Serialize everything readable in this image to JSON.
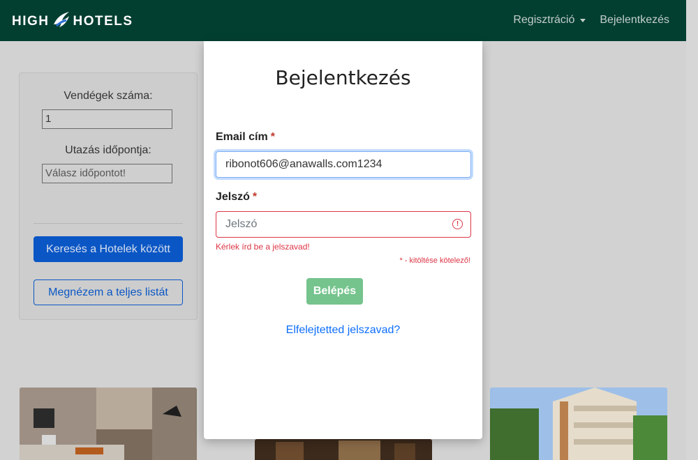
{
  "brand": {
    "left": "HIGH",
    "right": "HOTELS"
  },
  "nav": {
    "register": "Regisztráció",
    "login": "Bejelentkezés"
  },
  "search_panel": {
    "guests_label": "Vendégek száma:",
    "guests_value": "1",
    "date_label": "Utazás időpontja:",
    "date_placeholder": "Válasz időpontot!",
    "search_button": "Keresés a Hotelek között",
    "list_button": "Megnézem a teljes listát"
  },
  "modal": {
    "title": "Bejelentkezés",
    "email_label": "Email cím",
    "required_mark": "*",
    "email_value": "ribonot606@anawalls.com1234",
    "password_label": "Jelszó",
    "password_placeholder": "Jelszó",
    "password_error": "Kérlek írd be a jelszavad!",
    "required_note": "* - kitöltése kötelező!",
    "login_button": "Belépés",
    "forgot_link": "Elfelejtetted jelszavad?"
  },
  "colors": {
    "navbar": "#023f31",
    "primary": "#0a56c5",
    "error": "#dc3545",
    "success": "#75c38d"
  }
}
